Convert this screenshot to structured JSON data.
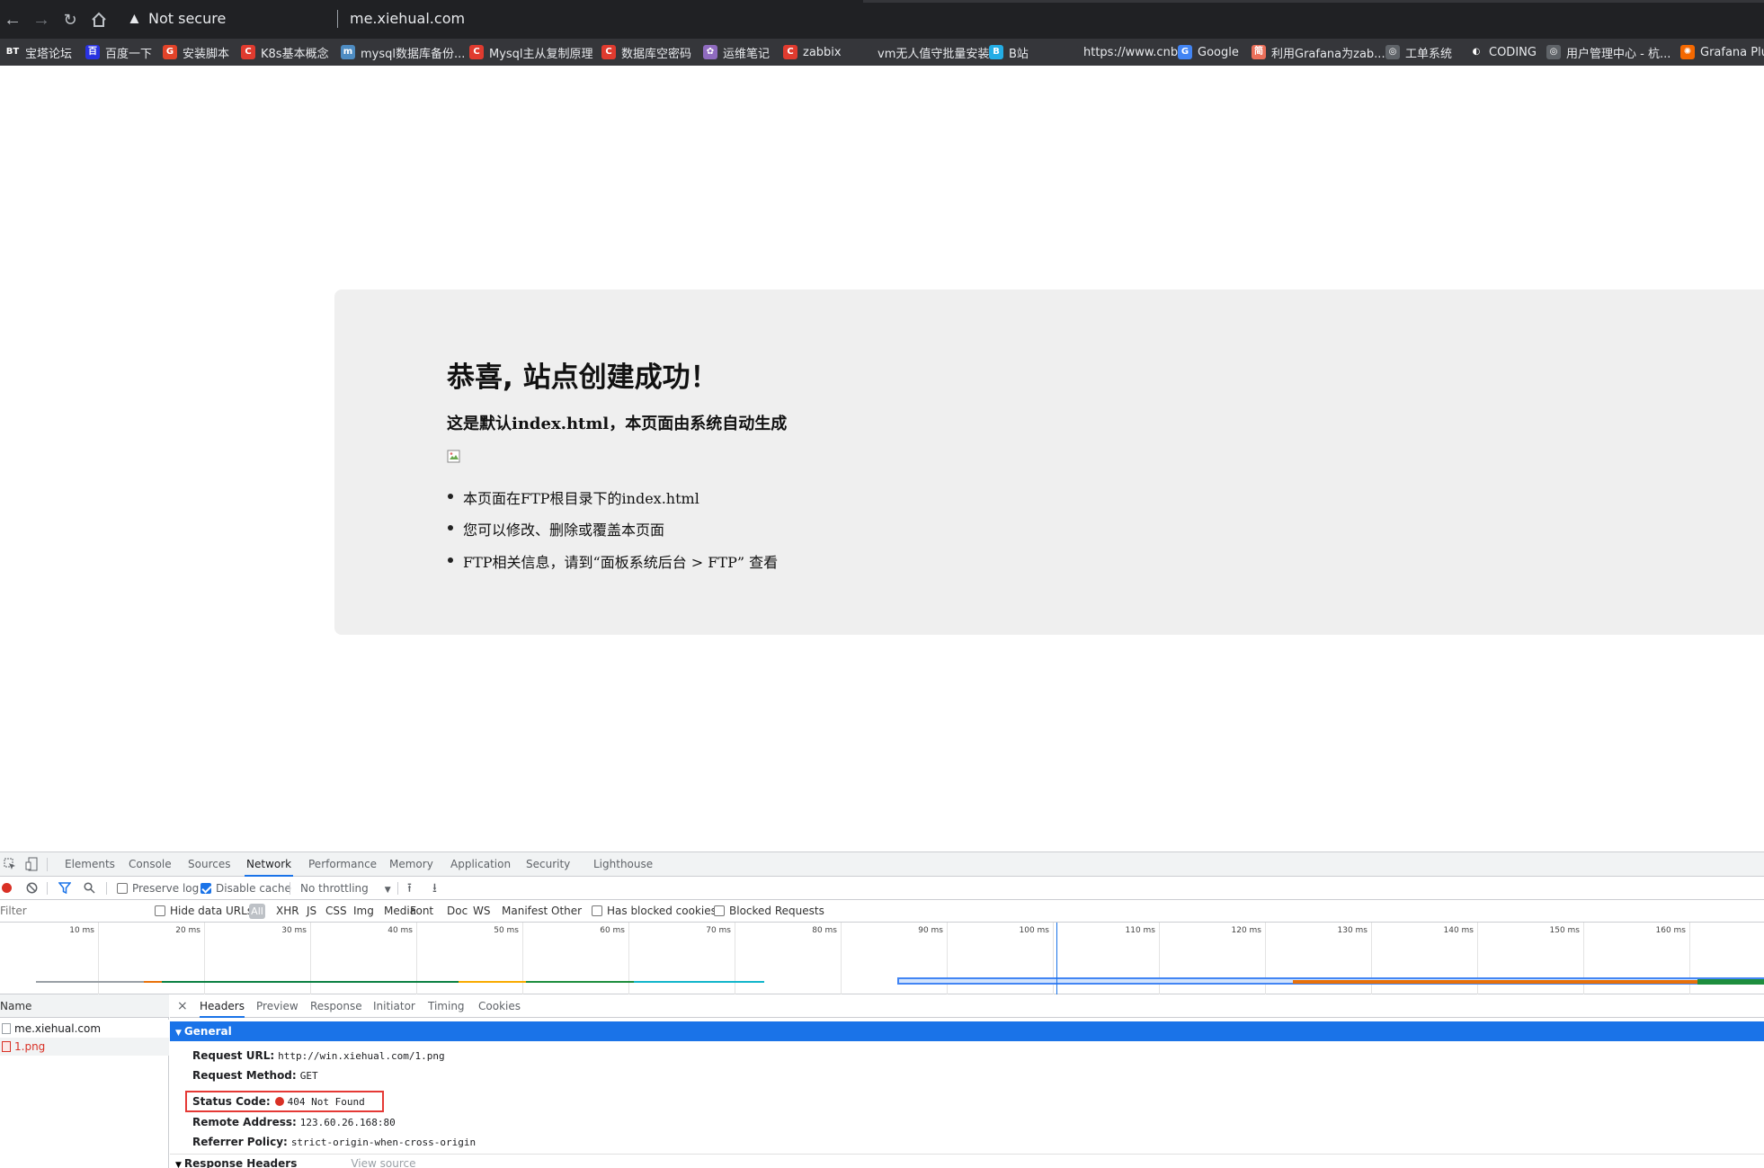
{
  "browser": {
    "security_label": "Not secure",
    "url": "me.xiehual.com",
    "icons": {
      "back": "back-arrow-icon",
      "forward": "forward-arrow-icon",
      "reload": "reload-icon",
      "home": "home-icon",
      "warning": "warning-triangle-icon"
    }
  },
  "bookmarks": [
    {
      "label": "宝塔论坛",
      "icon": "BT",
      "color": "#35363a"
    },
    {
      "label": "百度一下",
      "icon": "百",
      "color": "#2932e1"
    },
    {
      "label": "安装脚本",
      "icon": "G",
      "color": "#e24329"
    },
    {
      "label": "K8s基本概念",
      "icon": "C",
      "color": "#e03b2f"
    },
    {
      "label": "mysql数据库备份...",
      "icon": "m",
      "color": "#4e8cc2"
    },
    {
      "label": "Mysql主从复制原理",
      "icon": "C",
      "color": "#e03b2f"
    },
    {
      "label": "数据库空密码",
      "icon": "C",
      "color": "#e03b2f"
    },
    {
      "label": "运维笔记",
      "icon": "✿",
      "color": "#8f6bbf"
    },
    {
      "label": "zabbix",
      "icon": "C",
      "color": "#e03b2f"
    },
    {
      "label": "vm无人值守批量安装",
      "icon": "",
      "color": "#35363a"
    },
    {
      "label": "B站",
      "icon": "B",
      "color": "#23ade5"
    },
    {
      "label": "https://www.cnbl...",
      "icon": "",
      "color": "#35363a"
    },
    {
      "label": "Google",
      "icon": "G",
      "color": "#4285f4"
    },
    {
      "label": "利用Grafana为zab...",
      "icon": "简",
      "color": "#ea6f5a"
    },
    {
      "label": "工单系统",
      "icon": "◎",
      "color": "#5f6368"
    },
    {
      "label": "CODING",
      "icon": "◐",
      "color": "#35363a"
    },
    {
      "label": "用户管理中心 - 杭...",
      "icon": "◎",
      "color": "#5f6368"
    },
    {
      "label": "Grafana Plug",
      "icon": "✺",
      "color": "#f46800"
    }
  ],
  "page": {
    "title": "恭喜, 站点创建成功！",
    "subtitle": "这是默认index.html，本页面由系统自动生成",
    "items": [
      "本页面在FTP根目录下的index.html",
      "您可以修改、删除或覆盖本页面",
      "FTP相关信息，请到“面板系统后台 > FTP” 查看"
    ]
  },
  "devtools": {
    "tabs": [
      "Elements",
      "Console",
      "Sources",
      "Network",
      "Performance",
      "Memory",
      "Application",
      "Security",
      "Lighthouse"
    ],
    "active_tab": "Network",
    "toolbar": {
      "preserve_log": "Preserve log",
      "disable_cache": "Disable cache",
      "throttling": "No throttling"
    },
    "filter": {
      "placeholder": "Filter",
      "hide_data_urls": "Hide data URLs",
      "all": "All",
      "types": [
        "XHR",
        "JS",
        "CSS",
        "Img",
        "Media",
        "Font",
        "Doc",
        "WS",
        "Manifest",
        "Other"
      ],
      "has_blocked_cookies": "Has blocked cookies",
      "blocked_requests": "Blocked Requests"
    },
    "timeline_ticks": [
      "10 ms",
      "20 ms",
      "30 ms",
      "40 ms",
      "50 ms",
      "60 ms",
      "70 ms",
      "80 ms",
      "90 ms",
      "100 ms",
      "110 ms",
      "120 ms",
      "130 ms",
      "140 ms",
      "150 ms",
      "160 ms"
    ],
    "name_header": "Name",
    "requests": [
      {
        "name": "me.xiehual.com",
        "error": false
      },
      {
        "name": "1.png",
        "error": true
      }
    ],
    "detail_tabs": [
      "Headers",
      "Preview",
      "Response",
      "Initiator",
      "Timing",
      "Cookies"
    ],
    "general_label": "General",
    "general": [
      {
        "key": "Request URL:",
        "value": "http://win.xiehual.com/1.png"
      },
      {
        "key": "Request Method:",
        "value": "GET"
      },
      {
        "key": "Status Code:",
        "value": "404 Not Found"
      },
      {
        "key": "Remote Address:",
        "value": "123.60.26.168:80"
      },
      {
        "key": "Referrer Policy:",
        "value": "strict-origin-when-cross-origin"
      }
    ],
    "response_headers_label": "Response Headers",
    "view_source": "View source"
  }
}
